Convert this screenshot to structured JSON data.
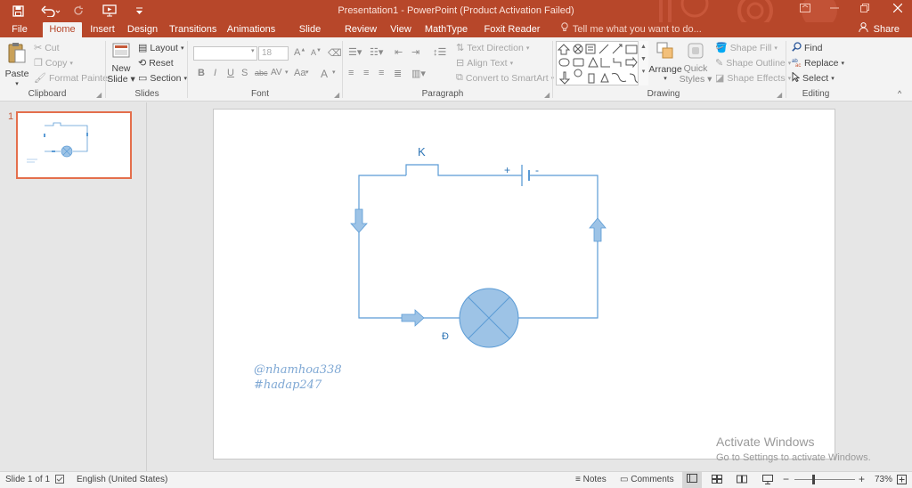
{
  "app": {
    "window_title": "Presentation1 - PowerPoint (Product Activation Failed)",
    "accent": "#b7472a"
  },
  "quick_access": {
    "save_icon": "save-icon",
    "undo_icon": "undo-icon",
    "redo_icon": "redo-icon",
    "present_icon": "present-from-start-icon",
    "customize_icon": "customize-icon"
  },
  "tabs": [
    {
      "label": "File"
    },
    {
      "label": "Home"
    },
    {
      "label": "Insert"
    },
    {
      "label": "Design"
    },
    {
      "label": "Transitions"
    },
    {
      "label": "Animations"
    },
    {
      "label": "Slide Show"
    },
    {
      "label": "Review"
    },
    {
      "label": "View"
    },
    {
      "label": "MathType"
    },
    {
      "label": "Foxit Reader PDF"
    }
  ],
  "tell_me": "Tell me what you want to do...",
  "share": "Share",
  "ribbon": {
    "clipboard": {
      "label": "Clipboard",
      "paste": "Paste",
      "cut": "Cut",
      "copy": "Copy",
      "format_painter": "Format Painter"
    },
    "slides": {
      "label": "Slides",
      "new_slide_1": "New",
      "new_slide_2": "Slide",
      "layout": "Layout",
      "reset": "Reset",
      "section": "Section"
    },
    "font": {
      "label": "Font",
      "size": "18",
      "bold": "B",
      "italic": "I",
      "underline": "U",
      "shadow": "S",
      "strike": "abc",
      "spacing": "AV",
      "case": "Aa",
      "color": "A"
    },
    "paragraph": {
      "label": "Paragraph",
      "text_direction": "Text Direction",
      "align_text": "Align Text",
      "smartart": "Convert to SmartArt"
    },
    "drawing": {
      "label": "Drawing",
      "arrange": "Arrange",
      "quick_styles_1": "Quick",
      "quick_styles_2": "Styles",
      "shape_fill": "Shape Fill",
      "shape_outline": "Shape Outline",
      "shape_effects": "Shape Effects"
    },
    "editing": {
      "label": "Editing",
      "find": "Find",
      "replace": "Replace",
      "select": "Select"
    }
  },
  "thumbnails": [
    {
      "number": "1"
    }
  ],
  "slide": {
    "switch_label": "K",
    "battery_plus": "+",
    "battery_minus": "-",
    "lamp_label": "Đ",
    "watermark_1": "@nhamhoa338",
    "watermark_2": "#hadap247",
    "line_color": "#5b9bd5",
    "fill_color": "#9dc3e6"
  },
  "activate": {
    "title": "Activate Windows",
    "subtitle": "Go to Settings to activate Windows."
  },
  "status": {
    "slide_of": "Slide 1 of 1",
    "language": "English (United States)",
    "notes": "Notes",
    "comments": "Comments",
    "zoom": "73%"
  }
}
